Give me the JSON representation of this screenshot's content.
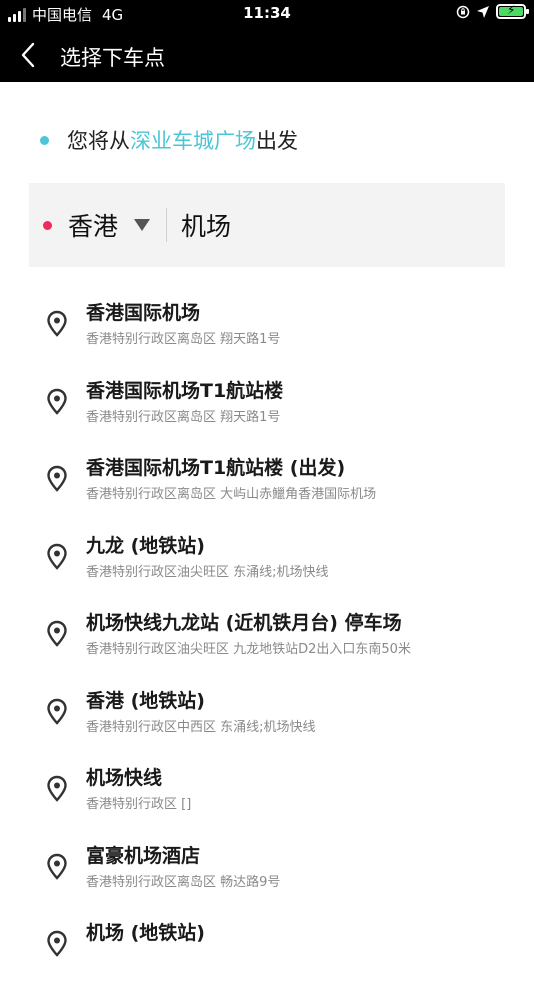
{
  "status_bar": {
    "carrier": "中国电信",
    "network": "4G",
    "time": "11:34"
  },
  "nav": {
    "title": "选择下车点"
  },
  "origin": {
    "prefix": "您将从",
    "place": "深业车城广场",
    "suffix": "出发"
  },
  "search": {
    "city": "香港",
    "query": "机场"
  },
  "results": [
    {
      "name": "香港国际机场",
      "address": "香港特别行政区离岛区 翔天路1号"
    },
    {
      "name": "香港国际机场T1航站楼",
      "address": "香港特别行政区离岛区 翔天路1号"
    },
    {
      "name": "香港国际机场T1航站楼 (出发)",
      "address": "香港特别行政区离岛区 大屿山赤鱲角香港国际机场"
    },
    {
      "name": "九龙 (地铁站)",
      "address": "香港特别行政区油尖旺区 东涌线;机场快线"
    },
    {
      "name": "机场快线九龙站 (近机铁月台) 停车场",
      "address": "香港特别行政区油尖旺区 九龙地铁站D2出入口东南50米"
    },
    {
      "name": "香港 (地铁站)",
      "address": "香港特别行政区中西区 东涌线;机场快线"
    },
    {
      "name": "机场快线",
      "address": "香港特别行政区 []"
    },
    {
      "name": "富豪机场酒店",
      "address": "香港特别行政区离岛区 畅达路9号"
    },
    {
      "name": "机场 (地铁站)",
      "address": ""
    }
  ],
  "colors": {
    "accent": "#4cc5d6",
    "destination_dot": "#ee2a5e",
    "battery": "#4cd964"
  }
}
